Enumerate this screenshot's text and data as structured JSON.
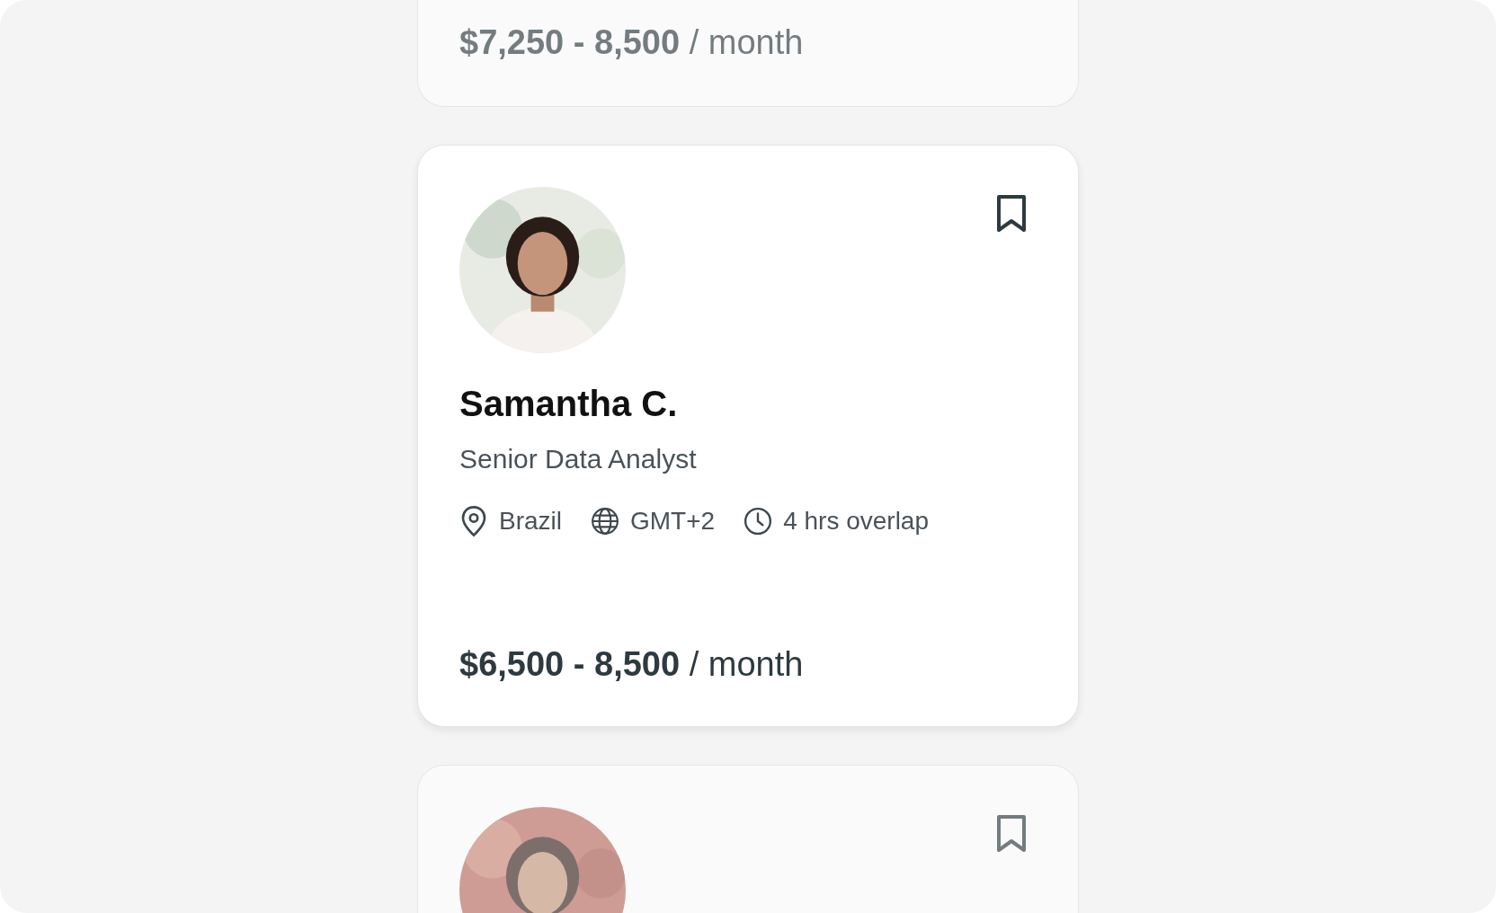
{
  "cards": [
    {
      "selected": false,
      "salary": {
        "range": "$7,250 - 8,500",
        "period": "/ month"
      }
    },
    {
      "selected": true,
      "name": "Samantha C.",
      "title": "Senior Data Analyst",
      "details": [
        {
          "kind": "location",
          "text": "Brazil"
        },
        {
          "kind": "timezone",
          "text": "GMT+2"
        },
        {
          "kind": "overlap",
          "text": "4 hrs overlap"
        }
      ],
      "salary": {
        "range": "$6,500 - 8,500",
        "period": "/ month"
      }
    },
    {
      "selected": false
    }
  ]
}
